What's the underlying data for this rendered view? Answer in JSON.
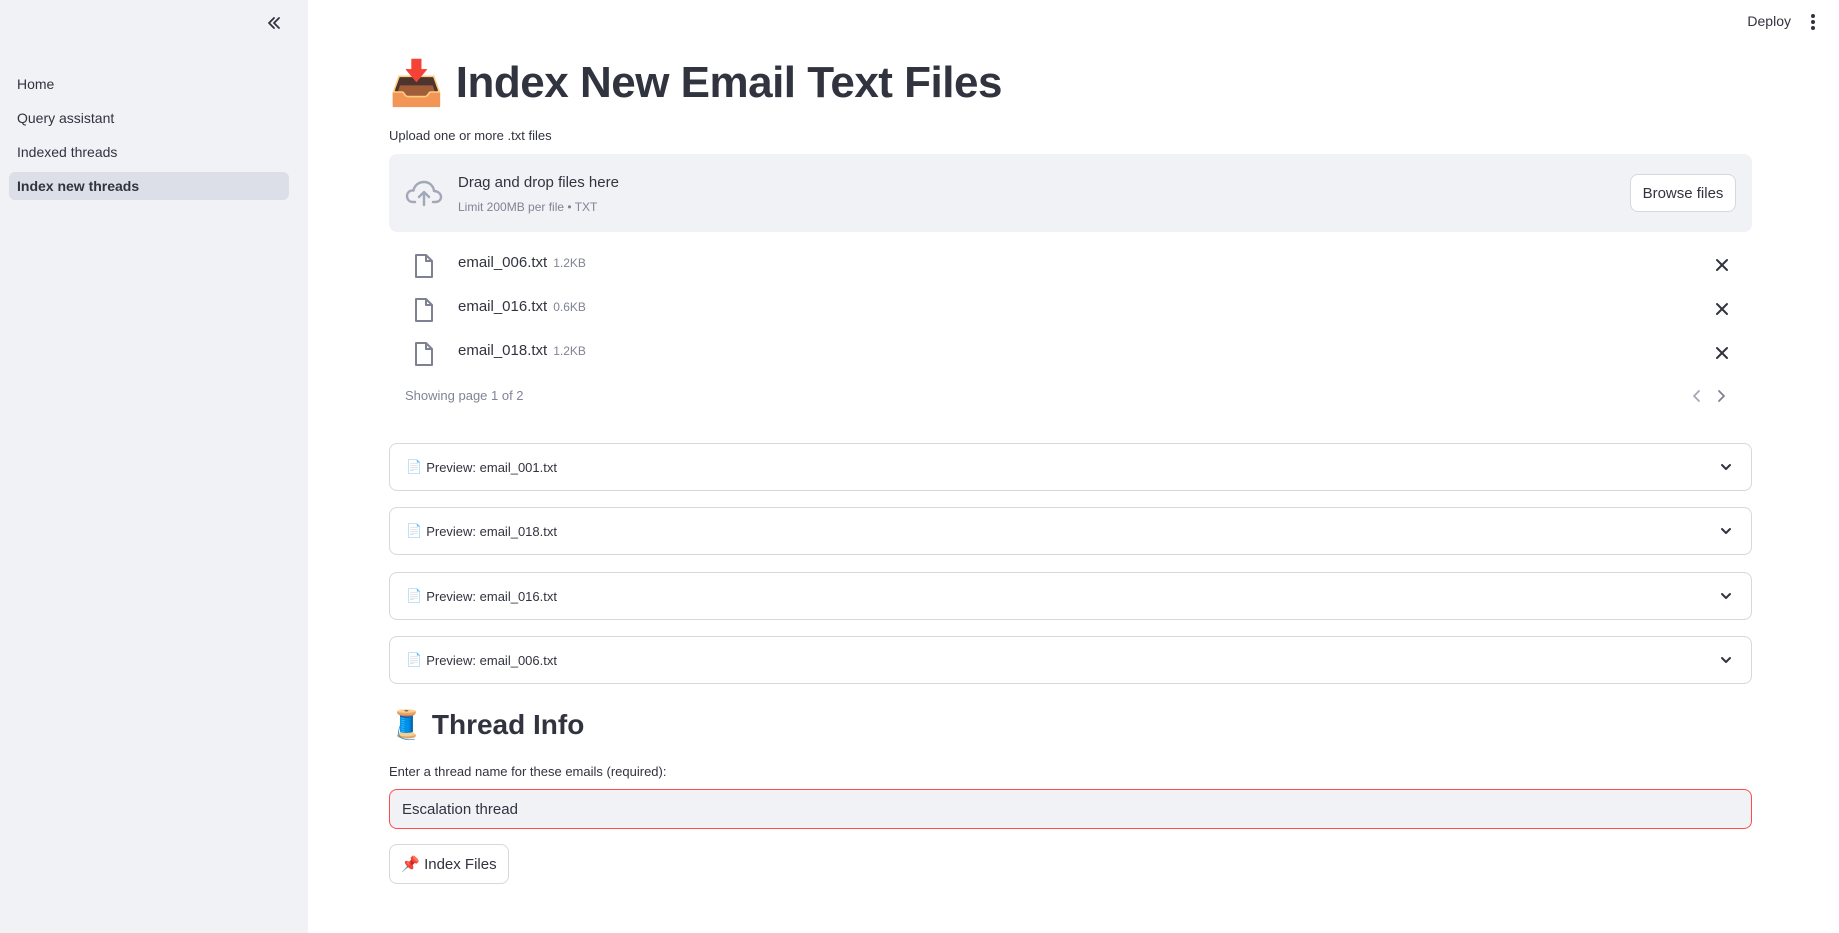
{
  "sidebar": {
    "collapse_icon": "double-chevron-left-icon",
    "items": [
      {
        "label": "Home",
        "active": false
      },
      {
        "label": "Query assistant",
        "active": false
      },
      {
        "label": "Indexed threads",
        "active": false
      },
      {
        "label": "Index new threads",
        "active": true
      }
    ]
  },
  "header": {
    "deploy_label": "Deploy",
    "menu_icon": "kebab-menu-icon"
  },
  "page": {
    "title_icon": "📥",
    "title": "Index New Email Text Files"
  },
  "uploader": {
    "label": "Upload one or more .txt files",
    "drop_title": "Drag and drop files here",
    "drop_subtitle": "Limit 200MB per file • TXT",
    "browse_label": "Browse files",
    "files": [
      {
        "name": "email_006.txt",
        "size": "1.2KB"
      },
      {
        "name": "email_016.txt",
        "size": "0.6KB"
      },
      {
        "name": "email_018.txt",
        "size": "1.2KB"
      }
    ],
    "pagination_text": "Showing page 1 of 2"
  },
  "previews": [
    {
      "icon": "📄",
      "label": "Preview: email_001.txt"
    },
    {
      "icon": "📄",
      "label": "Preview: email_018.txt"
    },
    {
      "icon": "📄",
      "label": "Preview: email_016.txt"
    },
    {
      "icon": "📄",
      "label": "Preview: email_006.txt"
    }
  ],
  "thread_info": {
    "icon": "🧵",
    "title": "Thread Info",
    "input_label": "Enter a thread name for these emails (required):",
    "input_value": "Escalation thread"
  },
  "action": {
    "icon": "📌",
    "label": "Index Files"
  },
  "colors": {
    "sidebar_bg": "#f0f2f6",
    "accent_error": "#ff4b4b",
    "text": "#31333f",
    "muted": "#808495"
  }
}
